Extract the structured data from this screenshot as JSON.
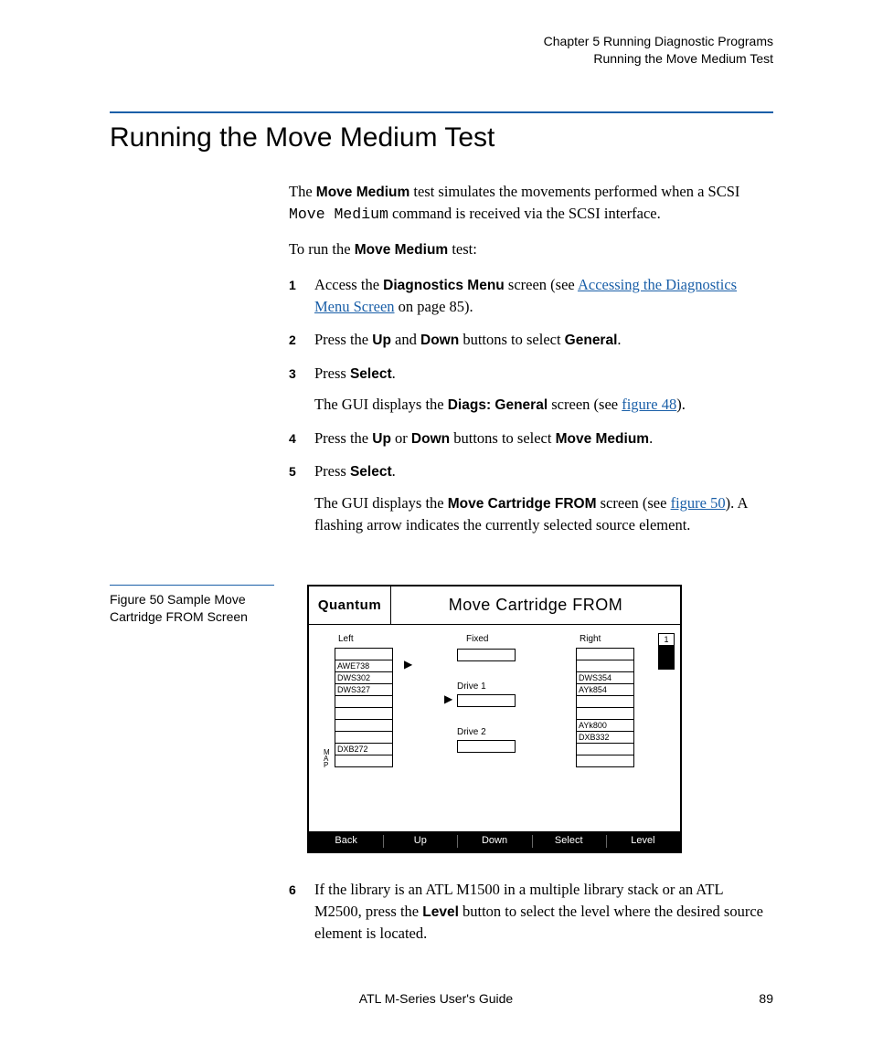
{
  "header": {
    "chapter": "Chapter 5  Running Diagnostic Programs",
    "section": "Running the Move Medium Test"
  },
  "title": "Running the Move Medium Test",
  "intro": {
    "p1_a": "The ",
    "p1_bold": "Move Medium",
    "p1_b": " test simulates the movements performed when a SCSI ",
    "p1_mono": "Move Medium",
    "p1_c": " command is received via the SCSI interface.",
    "p2_a": "To run the ",
    "p2_bold": "Move Medium",
    "p2_b": " test:"
  },
  "steps": {
    "s1": {
      "num": "1",
      "a": "Access the ",
      "b1": "Diagnostics Menu",
      "b": " screen (see ",
      "link": "Accessing the Diagnostics Menu Screen",
      "c": " on page 85)."
    },
    "s2": {
      "num": "2",
      "a": "Press the ",
      "b1": "Up",
      "b": " and ",
      "b2": "Down",
      "c": " buttons to select ",
      "b3": "General",
      "d": "."
    },
    "s3": {
      "num": "3",
      "a": "Press ",
      "b1": "Select",
      "b": ".",
      "sub_a": "The GUI displays the ",
      "sub_b1": "Diags: General",
      "sub_b": " screen (see ",
      "sub_link": "figure 48",
      "sub_c": ")."
    },
    "s4": {
      "num": "4",
      "a": "Press the ",
      "b1": "Up",
      "b": " or ",
      "b2": "Down",
      "c": " buttons to select ",
      "b3": "Move Medium",
      "d": "."
    },
    "s5": {
      "num": "5",
      "a": "Press ",
      "b1": "Select",
      "b": ".",
      "sub_a": "The GUI displays the ",
      "sub_b1": "Move Cartridge FROM",
      "sub_b": " screen (see ",
      "sub_link": "figure 50",
      "sub_c": "). A flashing arrow indicates the currently selected source element."
    },
    "s6": {
      "num": "6",
      "a": "If the library is an ATL M1500 in a multiple library stack or an ATL M2500, press the ",
      "b1": "Level",
      "b": " button to select the level where the desired source element is located."
    }
  },
  "figure_caption": "Figure 50  Sample Move Cartridge FROM Screen",
  "figure": {
    "brand": "Quantum",
    "title": "Move Cartridge  FROM",
    "labels": {
      "left": "Left",
      "fixed": "Fixed",
      "right": "Right",
      "drive1": "Drive 1",
      "drive2": "Drive 2",
      "map": "M\nA\nP"
    },
    "left_slots": [
      "",
      "AWE738",
      "DWS302",
      "DWS327",
      "",
      "",
      "",
      "",
      "DXB272",
      ""
    ],
    "right_slots": [
      "",
      "",
      "DWS354",
      "AYk854",
      "",
      "",
      "AYk800",
      "DXB332",
      "",
      ""
    ],
    "indicator_sel": "1",
    "buttons": [
      "Back",
      "Up",
      "Down",
      "Select",
      "Level"
    ]
  },
  "footer": {
    "center": "ATL M-Series User's Guide",
    "page": "89"
  }
}
